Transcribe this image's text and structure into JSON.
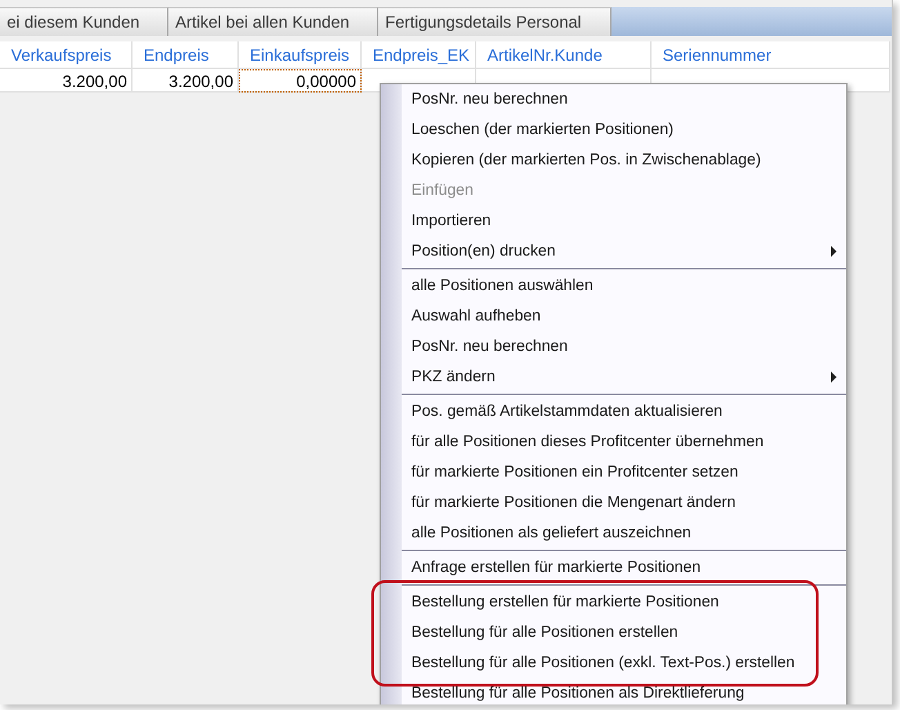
{
  "tabs": [
    {
      "label": "ei diesem Kunden",
      "selected": false
    },
    {
      "label": "Artikel bei allen Kunden",
      "selected": false
    },
    {
      "label": "Fertigungsdetails Personal",
      "selected": false
    }
  ],
  "table": {
    "columns": [
      "Verkaufspreis",
      "Endpreis",
      "Einkaufspreis",
      "Endpreis_EK",
      "ArtikelNr.Kunde",
      "Seriennummer"
    ],
    "rows": [
      {
        "cells": [
          {
            "text": "3.200,00",
            "focused": false
          },
          {
            "text": "3.200,00",
            "focused": false
          },
          {
            "text": "0,00000",
            "focused": true
          },
          {
            "text": "",
            "focused": false
          },
          {
            "text": "",
            "focused": false
          },
          {
            "text": "",
            "focused": false
          }
        ]
      }
    ]
  },
  "context_menu": {
    "items": [
      {
        "kind": "item",
        "label": "PosNr. neu berechnen",
        "disabled": false,
        "submenu": false,
        "annotated": false
      },
      {
        "kind": "item",
        "label": "Loeschen (der markierten Positionen)",
        "disabled": false,
        "submenu": false,
        "annotated": false
      },
      {
        "kind": "item",
        "label": "Kopieren (der markierten Pos. in Zwischenablage)",
        "disabled": false,
        "submenu": false,
        "annotated": false
      },
      {
        "kind": "item",
        "label": "Einfügen",
        "disabled": true,
        "submenu": false,
        "annotated": false
      },
      {
        "kind": "item",
        "label": "Importieren",
        "disabled": false,
        "submenu": false,
        "annotated": false
      },
      {
        "kind": "item",
        "label": "Position(en) drucken",
        "disabled": false,
        "submenu": true,
        "annotated": false
      },
      {
        "kind": "separator"
      },
      {
        "kind": "item",
        "label": "alle Positionen auswählen",
        "disabled": false,
        "submenu": false,
        "annotated": false
      },
      {
        "kind": "item",
        "label": "Auswahl aufheben",
        "disabled": false,
        "submenu": false,
        "annotated": false
      },
      {
        "kind": "item",
        "label": "PosNr. neu berechnen",
        "disabled": false,
        "submenu": false,
        "annotated": false
      },
      {
        "kind": "item",
        "label": "PKZ ändern",
        "disabled": false,
        "submenu": true,
        "annotated": false
      },
      {
        "kind": "separator"
      },
      {
        "kind": "item",
        "label": "Pos. gemäß Artikelstammdaten aktualisieren",
        "disabled": false,
        "submenu": false,
        "annotated": false
      },
      {
        "kind": "item",
        "label": "für alle Positionen dieses Profitcenter übernehmen",
        "disabled": false,
        "submenu": false,
        "annotated": false
      },
      {
        "kind": "item",
        "label": "für markierte Positionen ein Profitcenter setzen",
        "disabled": false,
        "submenu": false,
        "annotated": false
      },
      {
        "kind": "item",
        "label": "für markierte Positionen die Mengenart ändern",
        "disabled": false,
        "submenu": false,
        "annotated": false
      },
      {
        "kind": "item",
        "label": "alle Positionen als geliefert auszeichnen",
        "disabled": false,
        "submenu": false,
        "annotated": false
      },
      {
        "kind": "separator"
      },
      {
        "kind": "item",
        "label": "Anfrage erstellen für markierte Positionen",
        "disabled": false,
        "submenu": false,
        "annotated": false
      },
      {
        "kind": "separator"
      },
      {
        "kind": "item",
        "label": "Bestellung erstellen für markierte Positionen",
        "disabled": false,
        "submenu": false,
        "annotated": true
      },
      {
        "kind": "item",
        "label": "Bestellung für alle Positionen erstellen",
        "disabled": false,
        "submenu": false,
        "annotated": true
      },
      {
        "kind": "item",
        "label": "Bestellung für alle Positionen (exkl. Text-Pos.) erstellen",
        "disabled": false,
        "submenu": false,
        "annotated": true
      },
      {
        "kind": "item",
        "label": "Bestellung für alle Positionen als Direktlieferung",
        "disabled": false,
        "submenu": false,
        "annotated": false
      }
    ]
  }
}
